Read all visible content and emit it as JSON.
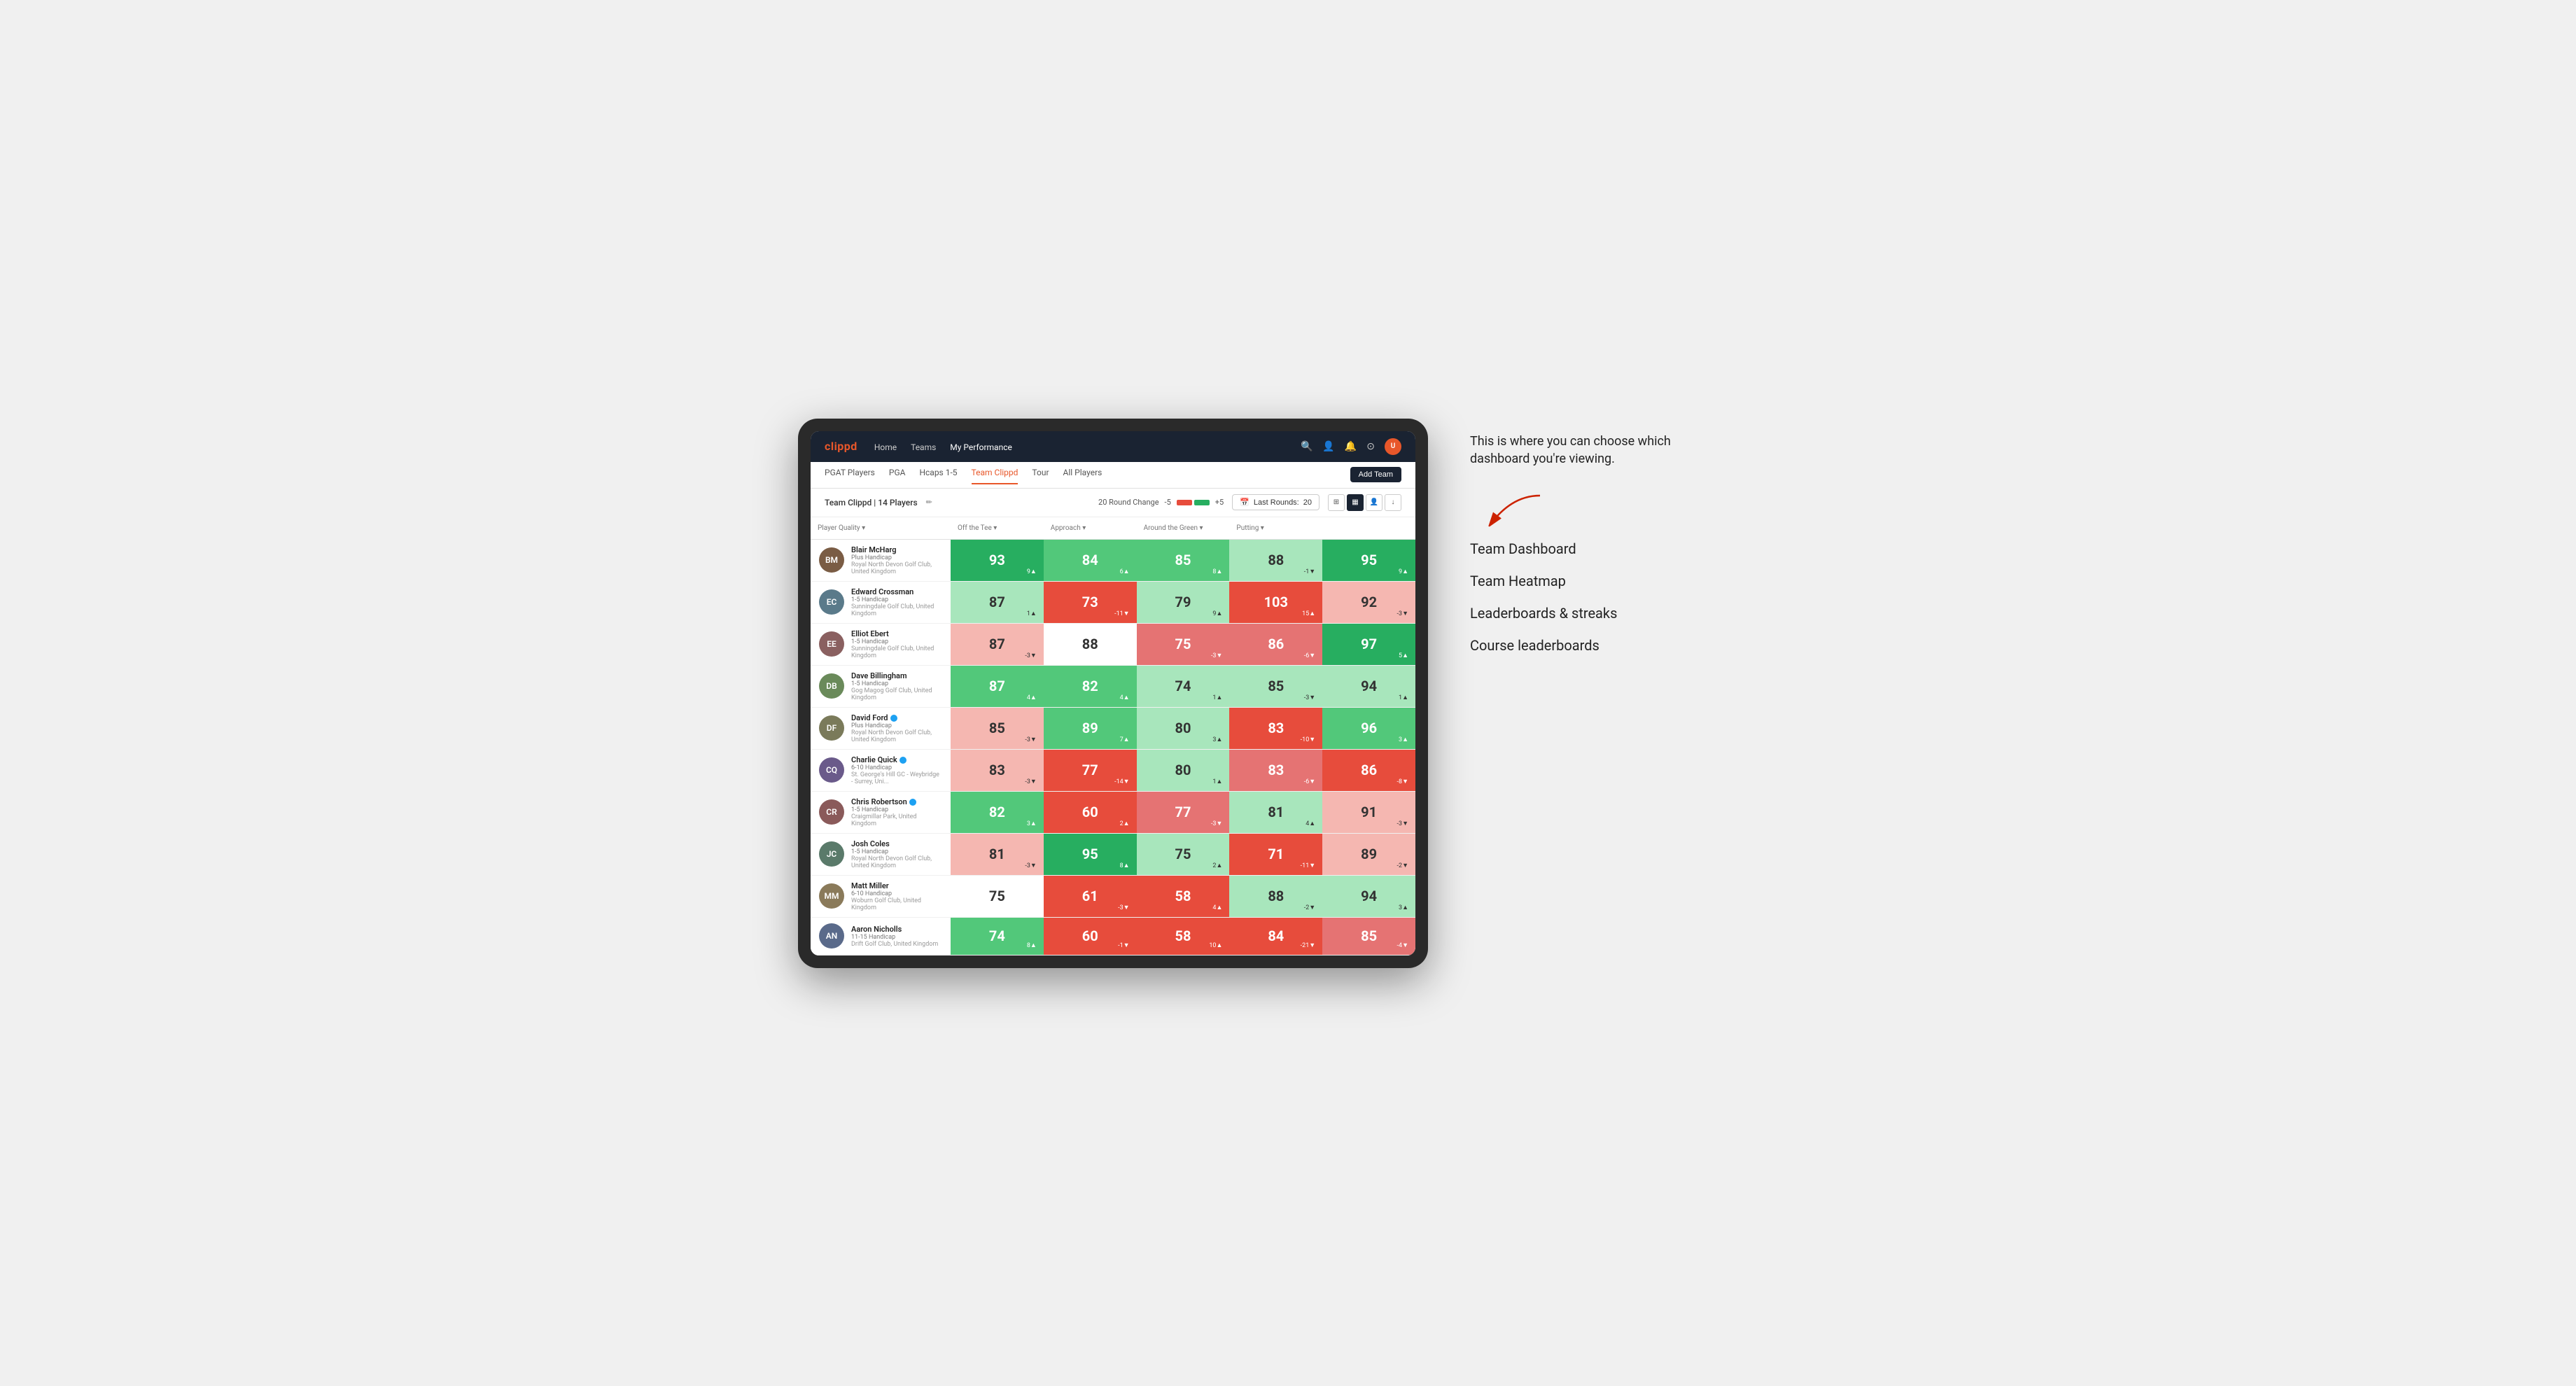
{
  "annotation": {
    "callout": "This is where you can choose which dashboard you're viewing.",
    "items": [
      "Team Dashboard",
      "Team Heatmap",
      "Leaderboards & streaks",
      "Course leaderboards"
    ]
  },
  "nav": {
    "logo": "clippd",
    "links": [
      "Home",
      "Teams",
      "My Performance"
    ],
    "active_link": "My Performance"
  },
  "sub_nav": {
    "links": [
      "PGAT Players",
      "PGA",
      "Hcaps 1-5",
      "Team Clippd",
      "Tour",
      "All Players"
    ],
    "active_link": "Team Clippd",
    "add_team_label": "Add Team"
  },
  "controls": {
    "team_name": "Team Clippd",
    "player_count": "14 Players",
    "round_change_label": "20 Round Change",
    "change_minus": "-5",
    "change_plus": "+5",
    "last_rounds_label": "Last Rounds:",
    "last_rounds_value": "20"
  },
  "table": {
    "headers": [
      "Player Quality ▾",
      "Off the Tee ▾",
      "Approach ▾",
      "Around the Green ▾",
      "Putting ▾"
    ],
    "rows": [
      {
        "name": "Blair McHarg",
        "hcp": "Plus Handicap",
        "club": "Royal North Devon Golf Club, United Kingdom",
        "avatar_class": "av1",
        "initials": "BM",
        "scores": [
          {
            "value": "93",
            "change": "9▲",
            "color": "green-strong"
          },
          {
            "value": "84",
            "change": "6▲",
            "color": "green-medium"
          },
          {
            "value": "85",
            "change": "8▲",
            "color": "green-medium"
          },
          {
            "value": "88",
            "change": "-1▼",
            "color": "green-light"
          },
          {
            "value": "95",
            "change": "9▲",
            "color": "green-strong"
          }
        ]
      },
      {
        "name": "Edward Crossman",
        "hcp": "1-5 Handicap",
        "club": "Sunningdale Golf Club, United Kingdom",
        "avatar_class": "av2",
        "initials": "EC",
        "scores": [
          {
            "value": "87",
            "change": "1▲",
            "color": "green-light"
          },
          {
            "value": "73",
            "change": "-11▼",
            "color": "red-strong"
          },
          {
            "value": "79",
            "change": "9▲",
            "color": "green-light"
          },
          {
            "value": "103",
            "change": "15▲",
            "color": "red-strong"
          },
          {
            "value": "92",
            "change": "-3▼",
            "color": "red-light"
          }
        ]
      },
      {
        "name": "Elliot Ebert",
        "hcp": "1-5 Handicap",
        "club": "Sunningdale Golf Club, United Kingdom",
        "avatar_class": "av3",
        "initials": "EE",
        "scores": [
          {
            "value": "87",
            "change": "-3▼",
            "color": "red-light"
          },
          {
            "value": "88",
            "change": "",
            "color": "neutral"
          },
          {
            "value": "75",
            "change": "-3▼",
            "color": "red-medium"
          },
          {
            "value": "86",
            "change": "-6▼",
            "color": "red-medium"
          },
          {
            "value": "97",
            "change": "5▲",
            "color": "green-strong"
          }
        ]
      },
      {
        "name": "Dave Billingham",
        "hcp": "1-5 Handicap",
        "club": "Gog Magog Golf Club, United Kingdom",
        "avatar_class": "av4",
        "initials": "DB",
        "scores": [
          {
            "value": "87",
            "change": "4▲",
            "color": "green-medium"
          },
          {
            "value": "82",
            "change": "4▲",
            "color": "green-medium"
          },
          {
            "value": "74",
            "change": "1▲",
            "color": "green-light"
          },
          {
            "value": "85",
            "change": "-3▼",
            "color": "green-light"
          },
          {
            "value": "94",
            "change": "1▲",
            "color": "green-light"
          }
        ]
      },
      {
        "name": "David Ford",
        "hcp": "Plus Handicap",
        "club": "Royal North Devon Golf Club, United Kingdom",
        "avatar_class": "av5",
        "initials": "DF",
        "verified": true,
        "scores": [
          {
            "value": "85",
            "change": "-3▼",
            "color": "red-light"
          },
          {
            "value": "89",
            "change": "7▲",
            "color": "green-medium"
          },
          {
            "value": "80",
            "change": "3▲",
            "color": "green-light"
          },
          {
            "value": "83",
            "change": "-10▼",
            "color": "red-strong"
          },
          {
            "value": "96",
            "change": "3▲",
            "color": "green-medium"
          }
        ]
      },
      {
        "name": "Charlie Quick",
        "hcp": "6-10 Handicap",
        "club": "St. George's Hill GC - Weybridge - Surrey, Uni...",
        "avatar_class": "av6",
        "initials": "CQ",
        "verified": true,
        "scores": [
          {
            "value": "83",
            "change": "-3▼",
            "color": "red-light"
          },
          {
            "value": "77",
            "change": "-14▼",
            "color": "red-strong"
          },
          {
            "value": "80",
            "change": "1▲",
            "color": "green-light"
          },
          {
            "value": "83",
            "change": "-6▼",
            "color": "red-medium"
          },
          {
            "value": "86",
            "change": "-8▼",
            "color": "red-strong"
          }
        ]
      },
      {
        "name": "Chris Robertson",
        "hcp": "1-5 Handicap",
        "club": "Craigmillar Park, United Kingdom",
        "avatar_class": "av7",
        "initials": "CR",
        "verified": true,
        "scores": [
          {
            "value": "82",
            "change": "3▲",
            "color": "green-medium"
          },
          {
            "value": "60",
            "change": "2▲",
            "color": "red-strong"
          },
          {
            "value": "77",
            "change": "-3▼",
            "color": "red-medium"
          },
          {
            "value": "81",
            "change": "4▲",
            "color": "green-light"
          },
          {
            "value": "91",
            "change": "-3▼",
            "color": "red-light"
          }
        ]
      },
      {
        "name": "Josh Coles",
        "hcp": "1-5 Handicap",
        "club": "Royal North Devon Golf Club, United Kingdom",
        "avatar_class": "av8",
        "initials": "JC",
        "scores": [
          {
            "value": "81",
            "change": "-3▼",
            "color": "red-light"
          },
          {
            "value": "95",
            "change": "8▲",
            "color": "green-strong"
          },
          {
            "value": "75",
            "change": "2▲",
            "color": "green-light"
          },
          {
            "value": "71",
            "change": "-11▼",
            "color": "red-strong"
          },
          {
            "value": "89",
            "change": "-2▼",
            "color": "red-light"
          }
        ]
      },
      {
        "name": "Matt Miller",
        "hcp": "6-10 Handicap",
        "club": "Woburn Golf Club, United Kingdom",
        "avatar_class": "av9",
        "initials": "MM",
        "scores": [
          {
            "value": "75",
            "change": "",
            "color": "neutral"
          },
          {
            "value": "61",
            "change": "-3▼",
            "color": "red-strong"
          },
          {
            "value": "58",
            "change": "4▲",
            "color": "red-strong"
          },
          {
            "value": "88",
            "change": "-2▼",
            "color": "green-light"
          },
          {
            "value": "94",
            "change": "3▲",
            "color": "green-light"
          }
        ]
      },
      {
        "name": "Aaron Nicholls",
        "hcp": "11-15 Handicap",
        "club": "Drift Golf Club, United Kingdom",
        "avatar_class": "av10",
        "initials": "AN",
        "scores": [
          {
            "value": "74",
            "change": "8▲",
            "color": "green-medium"
          },
          {
            "value": "60",
            "change": "-1▼",
            "color": "red-strong"
          },
          {
            "value": "58",
            "change": "10▲",
            "color": "red-strong"
          },
          {
            "value": "84",
            "change": "-21▼",
            "color": "red-strong"
          },
          {
            "value": "85",
            "change": "-4▼",
            "color": "red-medium"
          }
        ]
      }
    ]
  }
}
